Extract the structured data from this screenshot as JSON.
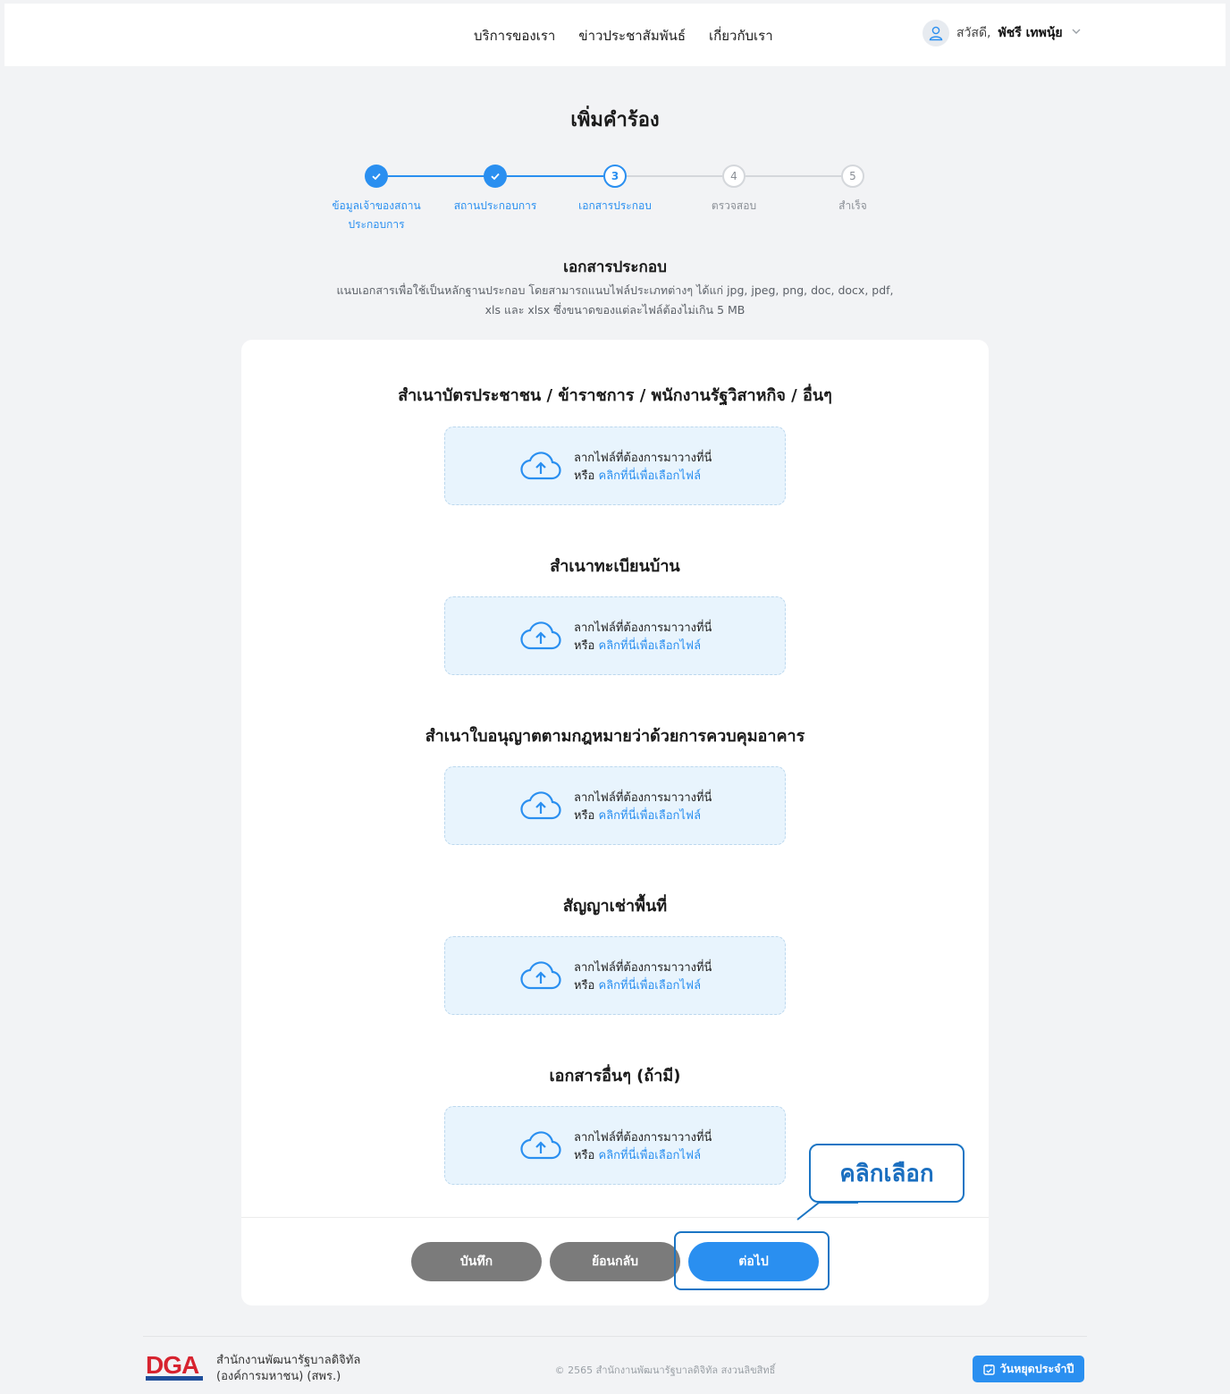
{
  "header": {
    "nav": [
      "บริการของเรา",
      "ข่าวประชาสัมพันธ์",
      "เกี่ยวกับเรา"
    ],
    "greeting": "สวัสดี,",
    "user_name": "พัชรี เทพนุ้ย"
  },
  "page": {
    "title": "เพิ่มคำร้อง"
  },
  "stepper": {
    "steps": [
      {
        "number": "1",
        "label": "ข้อมูลเจ้าของสถาน ประกอบการ",
        "status": "done"
      },
      {
        "number": "2",
        "label": "สถานประกอบการ",
        "status": "done"
      },
      {
        "number": "3",
        "label": "เอกสารประกอบ",
        "status": "current"
      },
      {
        "number": "4",
        "label": "ตรวจสอบ",
        "status": "todo"
      },
      {
        "number": "5",
        "label": "สำเร็จ",
        "status": "todo"
      }
    ]
  },
  "section": {
    "title": "เอกสารประกอบ",
    "description": "แนบเอกสารเพื่อใช้เป็นหลักฐานประกอบ โดยสามารถแนบไฟล์ประเภทต่างๆ ได้แก่ jpg, jpeg, png, doc, docx, pdf, xls และ xlsx ซึ่งขนาดของแต่ละไฟล์ต้องไม่เกิน 5 MB"
  },
  "documents": [
    {
      "title": "สำเนาบัตรประชาชน / ข้าราชการ / พนักงานรัฐวิสาหกิจ / อื่นๆ"
    },
    {
      "title": "สำเนาทะเบียนบ้าน"
    },
    {
      "title": "สำเนาใบอนุญาตตามกฎหมายว่าด้วยการควบคุมอาคาร"
    },
    {
      "title": "สัญญาเช่าพื้นที่"
    },
    {
      "title": "เอกสารอื่นๆ (ถ้ามี)"
    }
  ],
  "dropzone": {
    "line1": "ลากไฟล์ที่ต้องการมาวางที่นี่",
    "or": "หรือ",
    "link": "คลิกที่นี่เพื่อเลือกไฟล์"
  },
  "buttons": {
    "save": "บันทึก",
    "back": "ย้อนกลับ",
    "next": "ต่อไป"
  },
  "annotation": {
    "callout": "คลิกเลือก"
  },
  "footer": {
    "logo_text": "DGA",
    "org_line1": "สำนักงานพัฒนารัฐบาลดิจิทัล",
    "org_line2": "(องค์การมหาชน) (สพร.)",
    "copyright": "© 2565 สำนักงานพัฒนารัฐบาลดิจิทัล สงวนลิขสิทธิ์",
    "holiday_button": "วันหยุดประจำปี"
  },
  "colors": {
    "accent": "#2a8ff0",
    "grey_button": "#7b7b7b",
    "annotation": "#1b75c4"
  }
}
